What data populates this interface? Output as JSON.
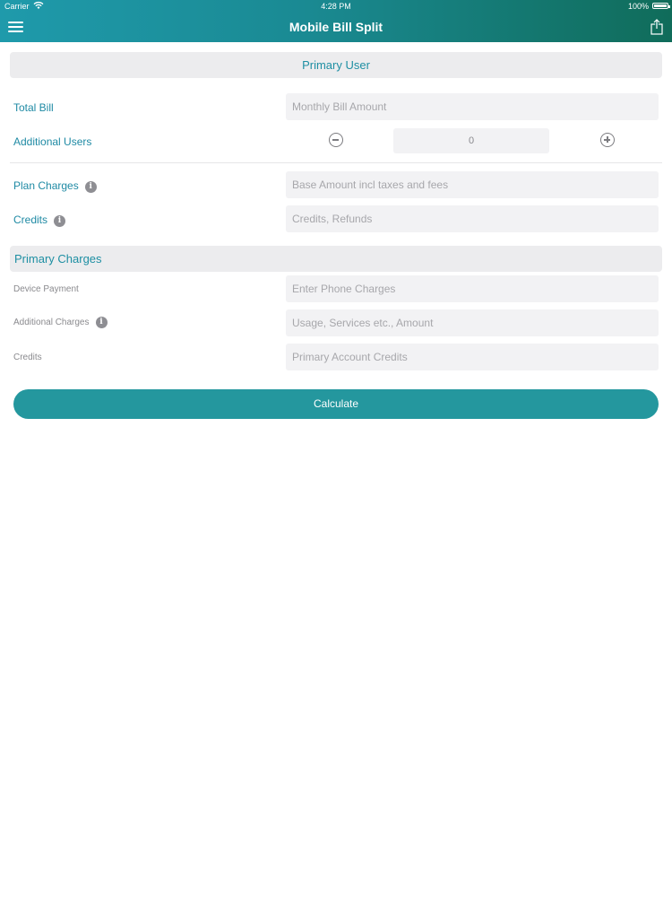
{
  "status_bar": {
    "carrier": "Carrier",
    "time": "4:28 PM",
    "battery": "100%"
  },
  "nav": {
    "title": "Mobile Bill Split",
    "menu_icon": "hamburger-menu-icon",
    "share_icon": "share-icon"
  },
  "primary_user": {
    "header": "Primary User",
    "total_bill": {
      "label": "Total Bill",
      "placeholder": "Monthly Bill Amount"
    },
    "additional_users": {
      "label": "Additional Users",
      "value": "0"
    },
    "plan_charges": {
      "label": "Plan Charges",
      "placeholder": "Base Amount incl taxes and fees",
      "info": "i"
    },
    "credits": {
      "label": "Credits",
      "placeholder": "Credits, Refunds",
      "info": "i"
    }
  },
  "primary_charges": {
    "header": "Primary Charges",
    "device_payment": {
      "label": "Device Payment",
      "placeholder": "Enter Phone Charges"
    },
    "additional_charges": {
      "label": "Additional Charges",
      "placeholder": "Usage, Services etc., Amount",
      "info": "i"
    },
    "credits": {
      "label": "Credits",
      "placeholder": "Primary Account Credits"
    }
  },
  "calculate_label": "Calculate",
  "colors": {
    "accent": "#1f8aa4",
    "button": "#24979e",
    "nav_start": "#1f9aab",
    "nav_end": "#106c5a"
  }
}
